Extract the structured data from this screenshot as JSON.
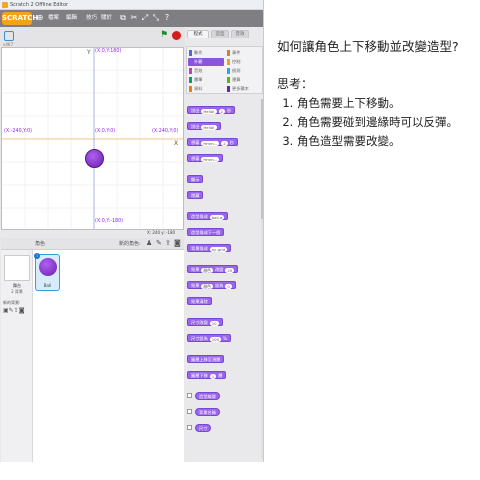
{
  "window": {
    "title": "Scratch 2 Offline Editor"
  },
  "menubar": {
    "logo": "SCRATCH",
    "items": [
      "檔案",
      "編輯",
      "技巧",
      "關於"
    ]
  },
  "stage": {
    "version": "v467",
    "coords": {
      "top": "(X:0,Y:180)",
      "bottom": "(X:0,Y:-180)",
      "left": "(X:-240,Y:0)",
      "right": "(X:240,Y:0)",
      "center": "(X:0,Y:0)"
    },
    "axis_x": "X",
    "axis_y": "Y",
    "mouse_readout": "X: 240  y: -180"
  },
  "sprites": {
    "header": "角色",
    "new_sprite_label": "新的角色:",
    "stage_label": "舞台",
    "stage_sub": "2 背景",
    "new_backdrop": "新的背景:",
    "sprite_name": "Ball",
    "info_icon": "i"
  },
  "palette": {
    "tabs": [
      "程式",
      "造型",
      "音效"
    ],
    "categories_left": [
      "動作",
      "外觀",
      "音效",
      "畫筆",
      "資料"
    ],
    "categories_right": [
      "事件",
      "控制",
      "偵測",
      "運算",
      "更多積木"
    ],
    "category_colors": [
      "#4a6cd4",
      "#8a55d7",
      "#bb42c3",
      "#0e9a6c",
      "#ee7d16",
      "#c88330",
      "#e1a91a",
      "#2ca5e2",
      "#5cb712",
      "#632d99"
    ],
    "blocks": [
      {
        "text": "說出",
        "slot": "Hello!",
        "slot2": "2",
        "suffix": "秒"
      },
      {
        "text": "說出",
        "slot": "Hello!"
      },
      {
        "text": "想著",
        "slot": "Hmm...",
        "slot2": "2",
        "suffix": "秒"
      },
      {
        "text": "想著",
        "slot": "Hmm..."
      },
      {
        "text": "顯示"
      },
      {
        "text": "隱藏"
      },
      {
        "text": "造型換成",
        "slot": "ball-a"
      },
      {
        "text": "造型換成下一個"
      },
      {
        "text": "背景換成",
        "slot": "xy-grid"
      },
      {
        "text": "效果",
        "slot": "顏色",
        "mid": "改變",
        "slot2": "25"
      },
      {
        "text": "效果",
        "slot": "顏色",
        "mid": "設為",
        "slot2": "0"
      },
      {
        "text": "效果清除"
      },
      {
        "text": "尺寸改變",
        "slot2": "10"
      },
      {
        "text": "尺寸設為",
        "slot2": "100",
        "suffix": "%"
      },
      {
        "text": "圖層上移至頂層"
      },
      {
        "text": "圖層下移",
        "slot2": "1",
        "suffix": "層"
      },
      {
        "text": "造型編號"
      },
      {
        "text": "背景名稱"
      },
      {
        "text": "尺寸"
      }
    ]
  },
  "notes": {
    "question": "如何讓角色上下移動並改變造型?",
    "think_label": "思考：",
    "requirements": [
      "角色需要上下移動。",
      "角色需要碰到邊緣時可以反彈。",
      "角色造型需要改變。"
    ]
  }
}
